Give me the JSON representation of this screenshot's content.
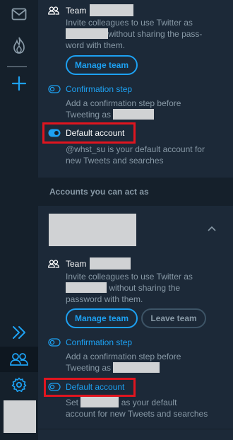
{
  "rail": {
    "icons": [
      "mail-icon",
      "fire-icon",
      "plus-icon",
      "expand-icon",
      "accounts-icon",
      "settings-icon"
    ]
  },
  "account_1": {
    "team_label": "Team",
    "team_desc_a": "Invite colleagues to use Twitter as",
    "team_desc_b": "without sharing the pass-",
    "team_desc_c": "word with them.",
    "manage_team": "Manage team",
    "confirm_title": "Confirmation step",
    "confirm_desc_a": "Add a confirmation step before",
    "confirm_desc_b": "Tweeting as",
    "default_title": "Default account",
    "default_desc_a": "@whst_su is your default account for",
    "default_desc_b": "new Tweets and searches"
  },
  "section_header": "Accounts you can act as",
  "account_2": {
    "team_label": "Team",
    "team_desc_a": "Invite colleagues to use Twitter as",
    "team_desc_b": "without sharing the",
    "team_desc_c": "password with them.",
    "manage_team": "Manage team",
    "leave_team": "Leave team",
    "confirm_title": "Confirmation step",
    "confirm_desc_a": "Add a confirmation step before",
    "confirm_desc_b": "Tweeting as",
    "default_title": "Default account",
    "default_desc_a": "Set",
    "default_desc_b": "as your default",
    "default_desc_c": "account for new Tweets and searches"
  },
  "colors": {
    "accent": "#1da1f2",
    "highlight": "#e0151f",
    "panel": "#1c2938",
    "rail": "#15202b",
    "muted_text": "#8899a6"
  }
}
